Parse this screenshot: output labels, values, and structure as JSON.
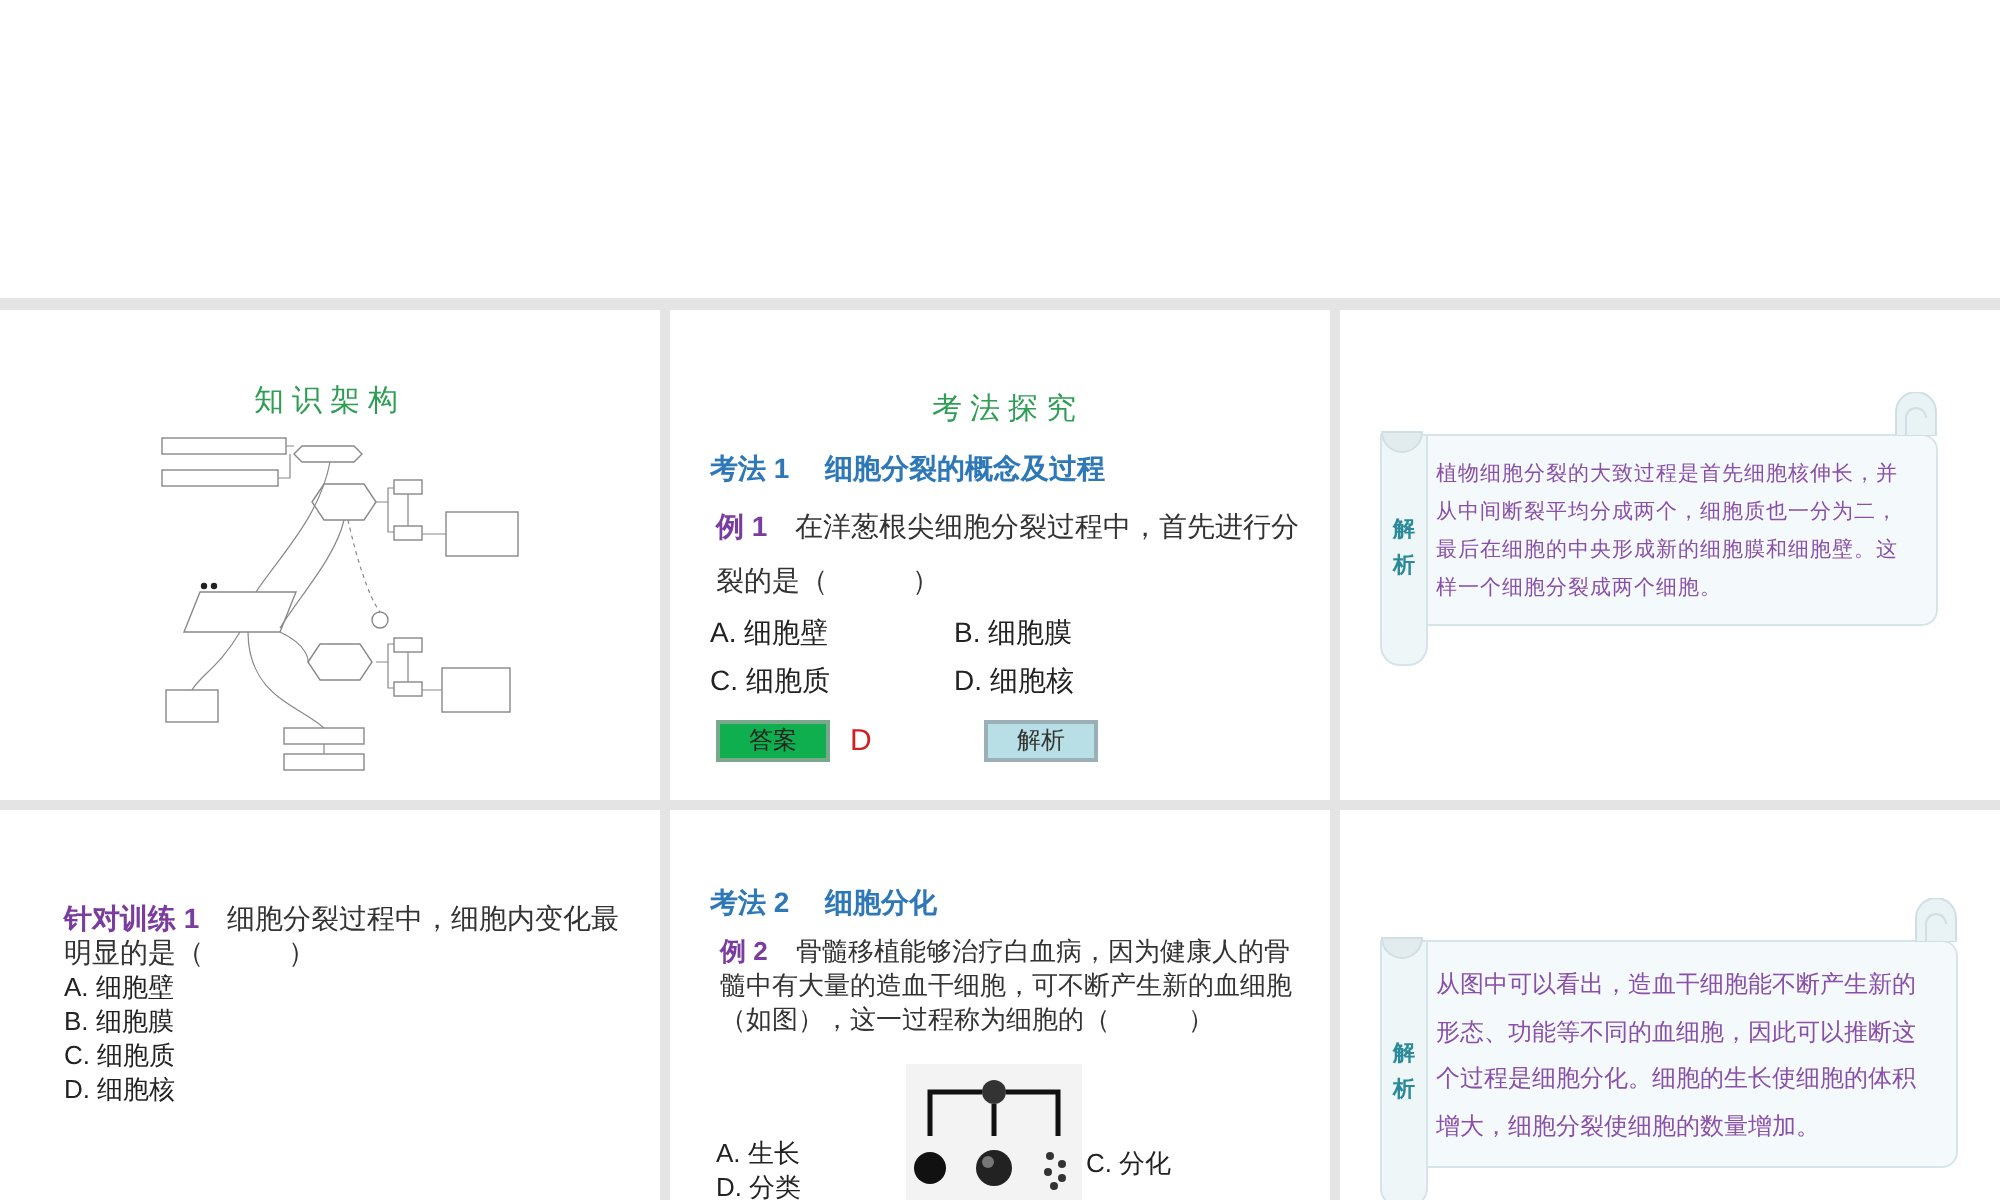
{
  "slides": [
    {
      "kind": "concept_map",
      "title": "知识架构"
    },
    {
      "kind": "example",
      "title": "考法探究",
      "heading": {
        "tag": "考法 1",
        "text": "细胞分裂的概念及过程"
      },
      "question": {
        "tag": "例 1",
        "text": "在洋葱根尖细胞分裂过程中，首先进行分裂的是（　　　）"
      },
      "options": [
        "A. 细胞壁",
        "B. 细胞膜",
        "C. 细胞质",
        "D. 细胞核"
      ],
      "answer_button": "答案",
      "answer": "D",
      "analysis_button": "解析"
    },
    {
      "kind": "analysis",
      "label": "解析",
      "text": "植物细胞分裂的大致过程是首先细胞核伸长，并从中间断裂平均分成两个，细胞质也一分为二，最后在细胞的中央形成新的细胞膜和细胞壁。这样一个细胞分裂成两个细胞。"
    },
    {
      "kind": "practice",
      "question": {
        "tag": "针对训练 1",
        "text": "细胞分裂过程中，细胞内变化最明显的是（　　　）"
      },
      "options": [
        "A. 细胞壁",
        "B. 细胞膜",
        "C. 细胞质",
        "D. 细胞核"
      ]
    },
    {
      "kind": "figure_example",
      "heading": {
        "tag": "考法 2",
        "text": "细胞分化"
      },
      "question": {
        "tag": "例 2",
        "text": "骨髓移植能够治疗白血病，因为健康人的骨髓中有大量的造血干细胞，可不断产生新的血细胞（如图），这一过程称为细胞的（　　　）"
      },
      "options": [
        "A. 生长",
        "C. 分化",
        "D. 分类"
      ]
    },
    {
      "kind": "analysis",
      "label": "解析",
      "text": "从图中可以看出，造血干细胞能不断产生新的形态、功能等不同的血细胞，因此可以推断这个过程是细胞分化。细胞的生长使细胞的体积增大，细胞分裂使细胞的数量增加。"
    }
  ]
}
